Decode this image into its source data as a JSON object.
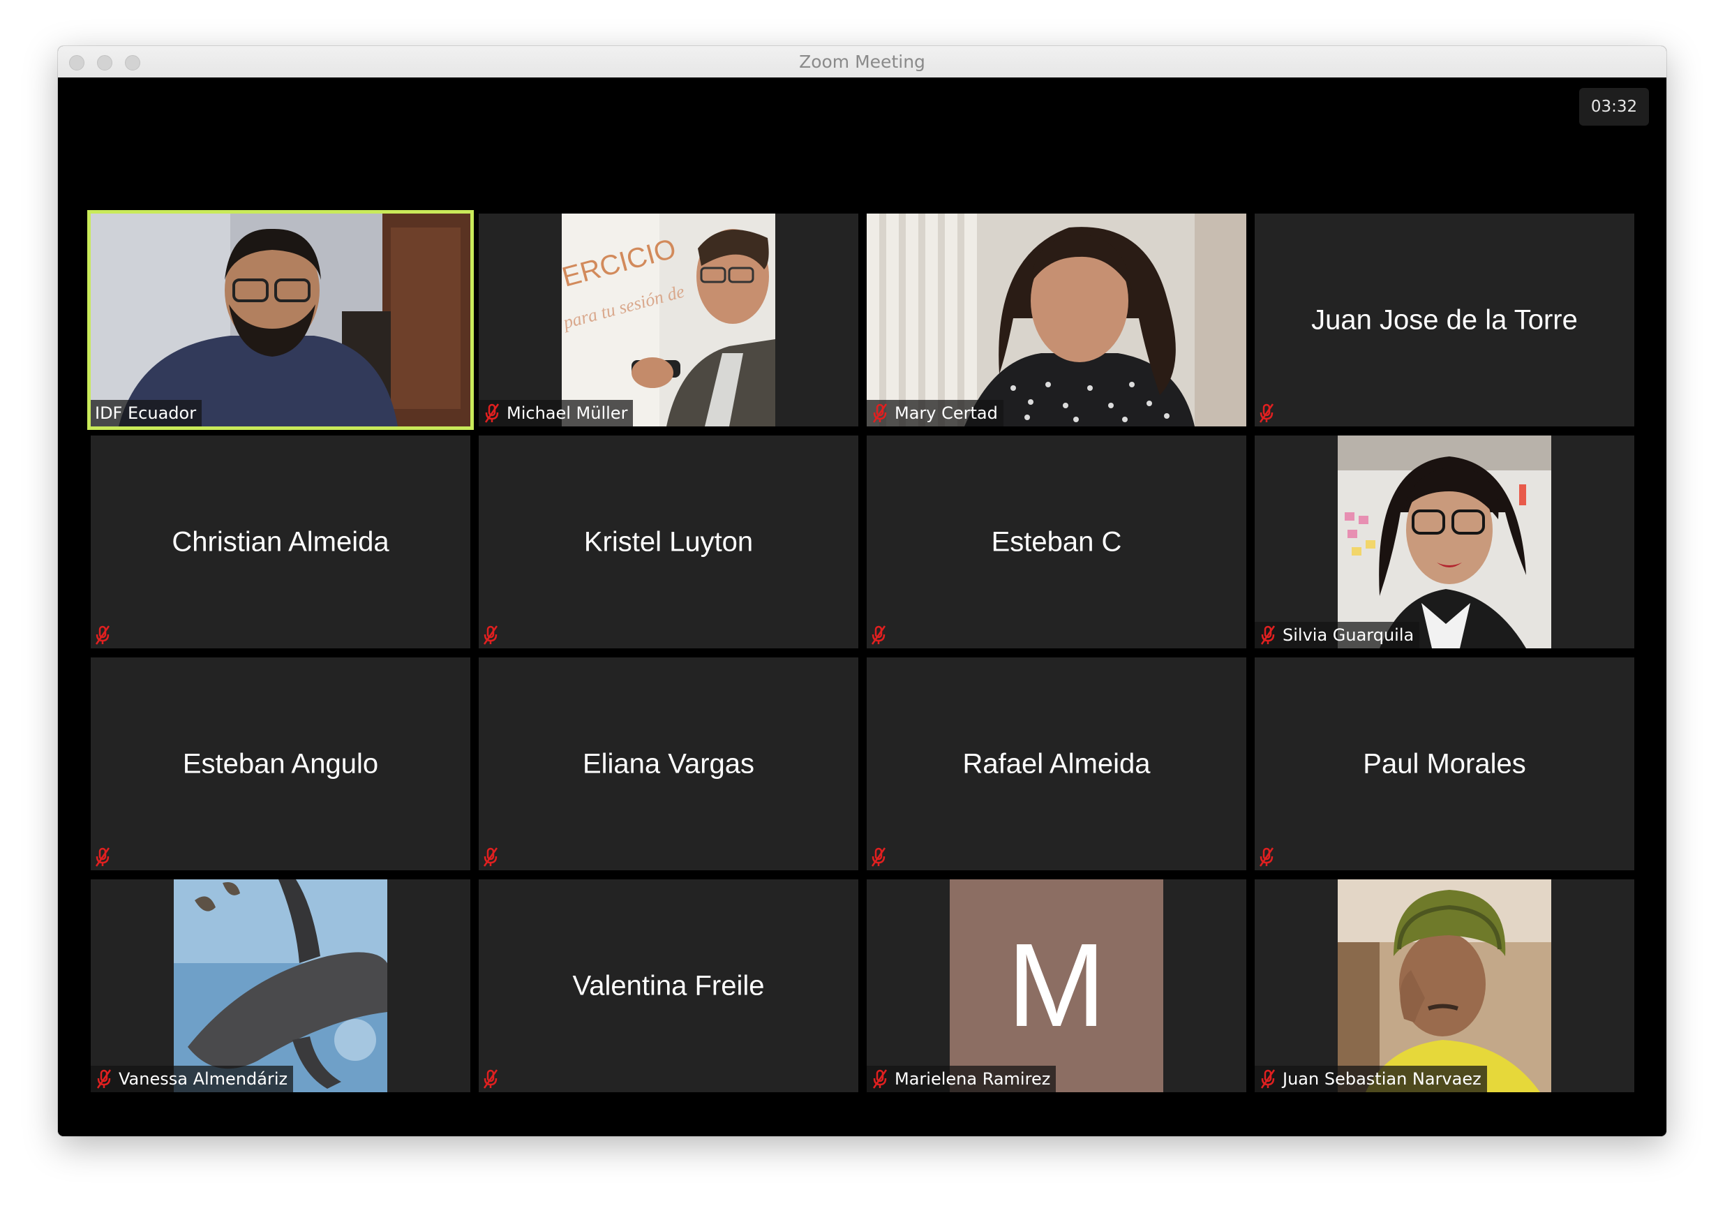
{
  "window": {
    "title": "Zoom Meeting",
    "timer": "03:32"
  },
  "colors": {
    "active_speaker_border": "#c9ea5a",
    "tile_background": "#232323",
    "muted_icon": "#e02020",
    "avatar_background": "#8c6e63"
  },
  "participants": [
    {
      "name": "IDF Ecuador",
      "video": true,
      "muted": false,
      "active": true
    },
    {
      "name": "Michael Müller",
      "video": true,
      "muted": true
    },
    {
      "name": "Mary Certad",
      "video": true,
      "muted": true
    },
    {
      "name": "Juan Jose de la Torre",
      "video": false,
      "muted": true
    },
    {
      "name": "Christian Almeida",
      "video": false,
      "muted": true
    },
    {
      "name": "Kristel Luyton",
      "video": false,
      "muted": true
    },
    {
      "name": "Esteban C",
      "video": false,
      "muted": true
    },
    {
      "name": "Silvia Guarquila",
      "video": true,
      "muted": true
    },
    {
      "name": "Esteban Angulo",
      "video": false,
      "muted": true
    },
    {
      "name": "Eliana Vargas",
      "video": false,
      "muted": true
    },
    {
      "name": "Rafael Almeida",
      "video": false,
      "muted": true
    },
    {
      "name": "Paul Morales",
      "video": false,
      "muted": true
    },
    {
      "name": "Vanessa Almendáriz",
      "video": true,
      "muted": true
    },
    {
      "name": "Valentina Freile",
      "video": false,
      "muted": true
    },
    {
      "name": "Marielena Ramirez",
      "video": false,
      "muted": true,
      "avatar_letter": "M"
    },
    {
      "name": "Juan Sebastian Narvaez",
      "video": true,
      "muted": true
    }
  ]
}
